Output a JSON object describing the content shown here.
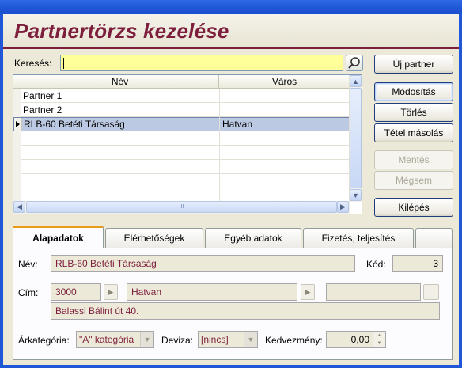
{
  "window": {
    "title": "Partnertörzs kezelése"
  },
  "search": {
    "label": "Keresés:",
    "value": ""
  },
  "grid": {
    "columns": [
      "Név",
      "Város"
    ],
    "rows": [
      {
        "name": "Partner 1",
        "city": ""
      },
      {
        "name": "Partner 2",
        "city": ""
      },
      {
        "name": "RLB-60 Betéti Társaság",
        "city": "Hatvan",
        "selected": true
      }
    ],
    "scroll_thumb_glyph": "III"
  },
  "actions": {
    "new": "Új partner",
    "modify": "Módosítás",
    "delete": "Törlés",
    "copy": "Tétel másolás",
    "save": "Mentés",
    "cancel": "Mégsem",
    "exit": "Kilépés"
  },
  "tabs": [
    "Alapadatok",
    "Elérhetőségek",
    "Egyéb adatok",
    "Fizetés, teljesítés"
  ],
  "details": {
    "name_label": "Név:",
    "name_value": "RLB-60 Betéti Társaság",
    "code_label": "Kód:",
    "code_value": "3",
    "address_label": "Cím:",
    "zip": "3000",
    "city": "Hatvan",
    "street": "Balassi Bálint út 40.",
    "ellipsis": "...",
    "price_category_label": "Árkategória:",
    "price_category_value": "\"A\" kategória",
    "currency_label": "Deviza:",
    "currency_value": "[nincs]",
    "discount_label": "Kedvezmény:",
    "discount_value": "0,00"
  },
  "colors": {
    "title": "#7d1f3c",
    "search_bg": "#ffff9a",
    "selection": "#bcc9e2",
    "active_tab_accent": "#e89a18"
  }
}
